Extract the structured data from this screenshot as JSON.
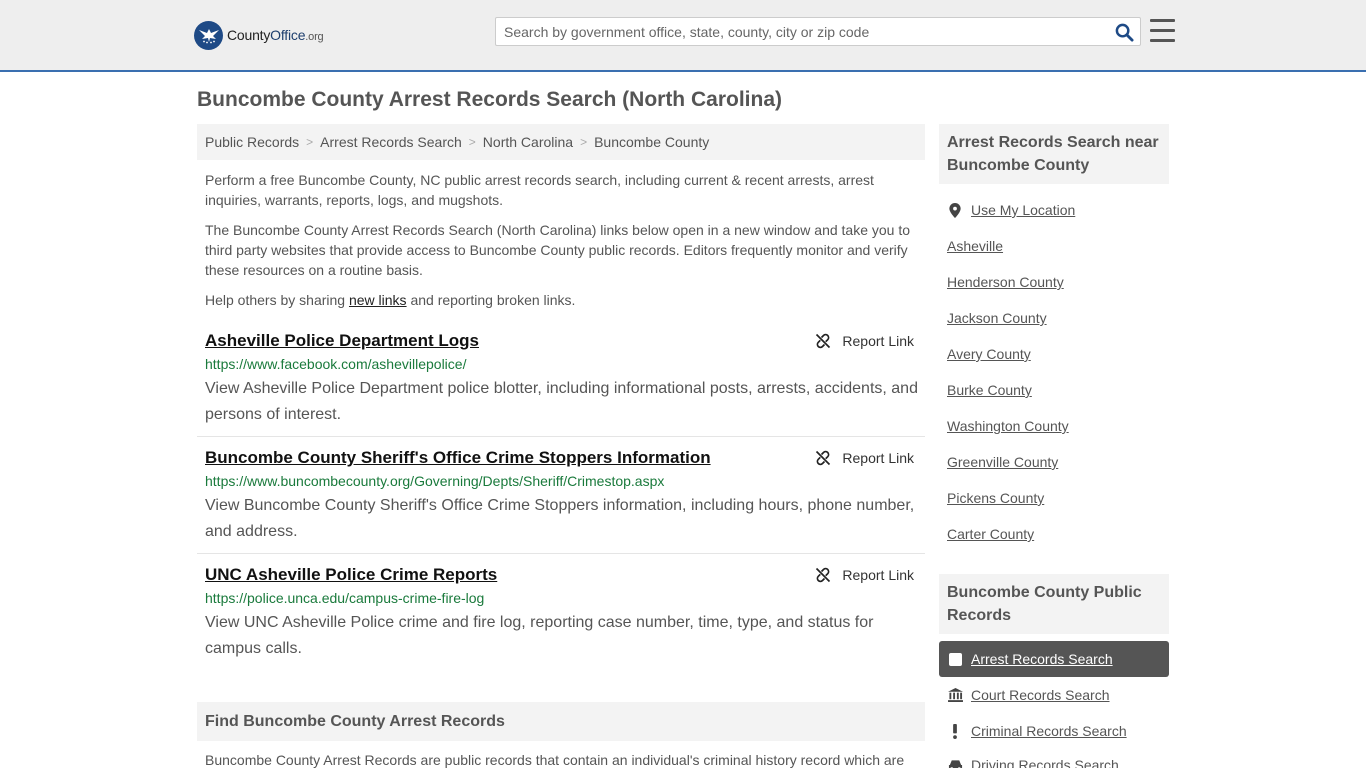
{
  "header": {
    "logo_main": "County",
    "logo_brand": "Office",
    "logo_tld": ".org",
    "search_placeholder": "Search by government office, state, county, city or zip code"
  },
  "page": {
    "title": "Buncombe County Arrest Records Search (North Carolina)"
  },
  "breadcrumb": [
    "Public Records",
    "Arrest Records Search",
    "North Carolina",
    "Buncombe County"
  ],
  "intro": {
    "p1": "Perform a free Buncombe County, NC public arrest records search, including current & recent arrests, arrest inquiries, warrants, reports, logs, and mugshots.",
    "p2": "The Buncombe County Arrest Records Search (North Carolina) links below open in a new window and take you to third party websites that provide access to Buncombe County public records. Editors frequently monitor and verify these resources on a routine basis.",
    "p3_before": "Help others by sharing ",
    "p3_link": "new links",
    "p3_after": " and reporting broken links."
  },
  "results": [
    {
      "title": "Asheville Police Department Logs",
      "url": "https://www.facebook.com/ashevillepolice/",
      "desc": "View Asheville Police Department police blotter, including informational posts, arrests, accidents, and persons of interest.",
      "report_label": "Report Link"
    },
    {
      "title": "Buncombe County Sheriff's Office Crime Stoppers Information",
      "url": "https://www.buncombecounty.org/Governing/Depts/Sheriff/Crimestop.aspx",
      "desc": "View Buncombe County Sheriff's Office Crime Stoppers information, including hours, phone number, and address.",
      "report_label": "Report Link"
    },
    {
      "title": "UNC Asheville Police Crime Reports",
      "url": "https://police.unca.edu/campus-crime-fire-log",
      "desc": "View UNC Asheville Police crime and fire log, reporting case number, time, type, and status for campus calls.",
      "report_label": "Report Link"
    }
  ],
  "find_section": {
    "heading": "Find Buncombe County Arrest Records",
    "text": "Buncombe County Arrest Records are public records that contain an individual's criminal history record which are"
  },
  "sidebar": {
    "nearby_heading": "Arrest Records Search near Buncombe County",
    "use_location": "Use My Location",
    "nearby": [
      "Asheville",
      "Henderson County",
      "Jackson County",
      "Avery County",
      "Burke County",
      "Washington County",
      "Greenville County",
      "Pickens County",
      "Carter County"
    ],
    "public_heading": "Buncombe County Public Records",
    "public_links": [
      {
        "label": "Arrest Records Search",
        "icon": "square-icon",
        "active": true
      },
      {
        "label": "Court Records Search",
        "icon": "courthouse-icon",
        "active": false
      },
      {
        "label": "Criminal Records Search",
        "icon": "exclamation-icon",
        "active": false
      },
      {
        "label": "Driving Records Search",
        "icon": "car-icon",
        "active": false
      }
    ]
  },
  "colors": {
    "accent": "#3a6fb0",
    "url_green": "#1a7a3c",
    "active_bg": "#555555"
  }
}
